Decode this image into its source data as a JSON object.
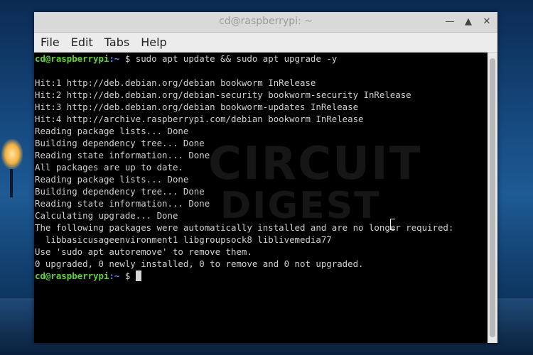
{
  "window": {
    "title": "cd@raspberrypi: ~",
    "minimize_icon": "minimize-icon",
    "maximize_icon": "maximize-icon",
    "close_icon": "close-icon"
  },
  "menu": {
    "items": [
      "File",
      "Edit",
      "Tabs",
      "Help"
    ]
  },
  "terminal": {
    "prompt_user": "cd@raspberrypi",
    "prompt_path": ":~",
    "prompt_symbol": " $ ",
    "command": "sudo apt update && sudo apt upgrade -y",
    "output_lines": [
      "Hit:1 http://deb.debian.org/debian bookworm InRelease",
      "Hit:2 http://deb.debian.org/debian-security bookworm-security InRelease",
      "Hit:3 http://deb.debian.org/debian bookworm-updates InRelease",
      "Hit:4 http://archive.raspberrypi.com/debian bookworm InRelease",
      "Reading package lists... Done",
      "Building dependency tree... Done",
      "Reading state information... Done",
      "All packages are up to date.",
      "Reading package lists... Done",
      "Building dependency tree... Done",
      "Reading state information... Done",
      "Calculating upgrade... Done",
      "The following packages were automatically installed and are no longer required:",
      "  libbasicusageenvironment1 libgroupsock8 liblivemedia77",
      "Use 'sudo apt autoremove' to remove them.",
      "0 upgraded, 0 newly installed, 0 to remove and 0 not upgraded."
    ]
  },
  "watermark": {
    "line1": "CIRCUIT",
    "line2": "DIGEST"
  },
  "colors": {
    "prompt_user": "#5ed33a",
    "prompt_path": "#5c8cf0",
    "terminal_bg": "#000000",
    "terminal_fg": "#cfcfcf",
    "titlebar_bg": "#d9d9d9"
  }
}
